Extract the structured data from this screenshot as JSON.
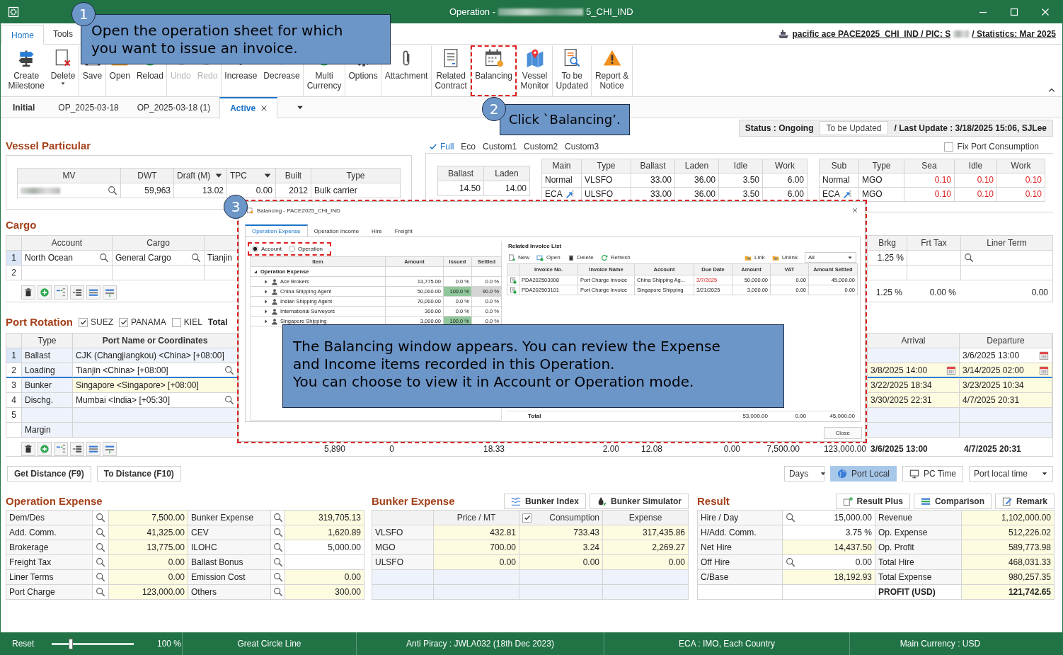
{
  "window": {
    "title_start": "Operation -",
    "title_end": "5_CHI_IND"
  },
  "ribbon": {
    "tabs": [
      {
        "label": "Home",
        "selected": true
      },
      {
        "label": "Tools",
        "selected": false
      }
    ],
    "context": {
      "start": "pacific ace PACE2025_CHI_IND / PIC: S",
      "end": "/ Statistics: Mar 2025"
    },
    "groups": [
      [
        {
          "label": "Create\nMilestone",
          "kind": "milestone",
          "disabled": false,
          "dropdown": false
        },
        {
          "label": "Delete",
          "kind": "delete",
          "disabled": false,
          "dropdown": true
        }
      ],
      [
        {
          "label": "Save",
          "kind": "save",
          "disabled": false,
          "dropdown": false
        }
      ],
      [
        {
          "label": "Open",
          "kind": "open",
          "disabled": false,
          "dropdown": false
        },
        {
          "label": "Reload",
          "kind": "reload",
          "disabled": false,
          "dropdown": false
        }
      ],
      [
        {
          "label": "Undo",
          "kind": "undo",
          "disabled": true,
          "dropdown": false
        },
        {
          "label": "Redo",
          "kind": "redo",
          "disabled": true,
          "dropdown": false
        }
      ],
      [
        {
          "label": "Increase",
          "kind": "increase",
          "disabled": false,
          "dropdown": false
        },
        {
          "label": "Decrease",
          "kind": "decrease",
          "disabled": false,
          "dropdown": false
        }
      ],
      [
        {
          "label": "Multi\nCurrency",
          "kind": "currency",
          "disabled": false,
          "dropdown": false
        }
      ],
      [
        {
          "label": "Options",
          "kind": "options",
          "disabled": false,
          "dropdown": false
        }
      ],
      [
        {
          "label": "Attachment",
          "kind": "attachment",
          "disabled": false,
          "dropdown": false
        }
      ],
      [
        {
          "label": "Related\nContract",
          "kind": "contract",
          "disabled": false,
          "dropdown": false
        }
      ],
      [
        {
          "label": "Balancing",
          "kind": "balancing",
          "disabled": false,
          "dropdown": false
        }
      ],
      [
        {
          "label": "Vessel\nMonitor",
          "kind": "map",
          "disabled": false,
          "dropdown": false
        }
      ],
      [
        {
          "label": "To be\nUpdated",
          "kind": "review",
          "disabled": false,
          "dropdown": false
        }
      ],
      [
        {
          "label": "Report &\nNotice",
          "kind": "warning",
          "disabled": false,
          "dropdown": false
        }
      ]
    ]
  },
  "doc_tabs": [
    {
      "label": "Initial",
      "kind": "base",
      "selected": false,
      "closable": false
    },
    {
      "label": "OP_2025-03-18",
      "kind": "version",
      "selected": false,
      "closable": false
    },
    {
      "label": "OP_2025-03-18 (1)",
      "kind": "version",
      "selected": false,
      "closable": false
    },
    {
      "label": "Active",
      "kind": "version",
      "selected": true,
      "closable": true
    }
  ],
  "status": {
    "label": "Status : Ongoing",
    "button": "To be Updated",
    "last_update": "/  Last Update : 3/18/2025 15:06, SJLee"
  },
  "vessel": {
    "title": "Vessel Particular",
    "columns": [
      {
        "label": "MV",
        "dropdown": false
      },
      {
        "label": "DWT",
        "dropdown": false
      },
      {
        "label": "Draft (M)",
        "dropdown": true
      },
      {
        "label": "TPC",
        "dropdown": true
      },
      {
        "label": "Built",
        "dropdown": false
      },
      {
        "label": "Type",
        "dropdown": false
      }
    ],
    "values": [
      "59,963",
      "13.02",
      "0.00",
      "2012",
      "Bulk carrier"
    ]
  },
  "speed": {
    "tabs": [
      {
        "label": "Full",
        "selected": true
      },
      {
        "label": "Eco",
        "selected": false
      },
      {
        "label": "Custom1",
        "selected": false
      },
      {
        "label": "Custom2",
        "selected": false
      },
      {
        "label": "Custom3",
        "selected": false
      }
    ],
    "fix_port_consumption": {
      "label": "Fix Port Consumption",
      "checked": false
    },
    "speed_columns": [
      "Ballast",
      "Laden"
    ],
    "speeds": [
      "14.50",
      "14.00"
    ],
    "main_columns": [
      "Main",
      "Type",
      "Ballast",
      "Laden",
      "Idle",
      "Work"
    ],
    "main_rows": [
      {
        "cells": [
          "Normal",
          "VLSFO",
          "33.00",
          "36.00",
          "3.50",
          "6.00"
        ],
        "eca": false
      },
      {
        "cells": [
          "ECA",
          "ULSFO",
          "33.00",
          "36.00",
          "3.50",
          "6.00"
        ],
        "eca": true
      }
    ],
    "sub_columns": [
      "Sub",
      "Type",
      "Sea",
      "Idle",
      "Work"
    ],
    "sub_rows": [
      {
        "cells": [
          "Normal",
          "MGO",
          "0.10",
          "0.10",
          "0.10"
        ],
        "eca": false,
        "alert": true
      },
      {
        "cells": [
          "ECA",
          "MGO",
          "0.10",
          "0.10",
          "0.10"
        ],
        "eca": true,
        "alert": true
      }
    ]
  },
  "cargo": {
    "title": "Cargo",
    "columns": [
      "Account",
      "Cargo"
    ],
    "rows": [
      {
        "number": "1",
        "account": "North Ocean",
        "cargo": "General Cargo",
        "column_3": "Tianjin",
        "selected": true
      },
      {
        "number": "2",
        "selected": false
      }
    ],
    "right_columns": [
      "Brkg",
      "Frt Tax",
      "Liner Term"
    ],
    "right_rows": [
      {
        "brkg": "1.25 %",
        "lookup": true
      },
      {
        "lookup": false
      }
    ],
    "totals": [
      "1.25 %",
      "0.00 %",
      "0.00"
    ]
  },
  "port_rotation": {
    "title": "Port Rotation",
    "canals": [
      {
        "label": "SUEZ",
        "checked": true
      },
      {
        "label": "PANAMA",
        "checked": true
      },
      {
        "label": "KIEL",
        "checked": false
      }
    ],
    "total_label": "Total",
    "columns": [
      "Type",
      "Port Name or Coordinates"
    ],
    "right_columns": [
      "Arrival",
      "Departure"
    ],
    "rows": [
      {
        "number": "1",
        "type": "Ballast",
        "port": "CJK (Changjiangkou) <China> [+08:00]",
        "lookup": false,
        "departure": "3/6/2025 13:00",
        "calendar": true,
        "kind": "ballast",
        "selected": true,
        "focused": false
      },
      {
        "number": "2",
        "type": "Loading",
        "port": "Tianjin <China> [+08:00]",
        "lookup": true,
        "arrival": "3/8/2025 14:00",
        "departure": "3/14/2025 02:00",
        "calendar": true,
        "kind": "call",
        "selected": false,
        "focused": true
      },
      {
        "number": "3",
        "type": "Bunker",
        "port": "Singapore <Singapore> [+08:00]",
        "lookup": false,
        "arrival": "3/22/2025 18:34",
        "departure": "3/23/2025 10:34",
        "calendar": false,
        "kind": "call",
        "selected": false,
        "focused": false
      },
      {
        "number": "4",
        "type": "Dischg.",
        "port": "Mumbai <India> [+05:30]",
        "lookup": true,
        "arrival": "3/30/2025 22:31",
        "departure": "4/7/2025 20:31",
        "calendar": false,
        "kind": "call",
        "selected": false,
        "focused": false
      },
      {
        "number": "5",
        "lookup": false,
        "calendar": false,
        "kind": "blank",
        "selected": false,
        "focused": false
      },
      {
        "type": "Margin",
        "lookup": false,
        "calendar": false,
        "kind": "margin",
        "selected": false,
        "focused": false
      }
    ],
    "totals": [
      "5,890",
      "0",
      "18.33",
      "2.00",
      "12.08",
      "0.00",
      "7,500.00",
      "123,000.00",
      "3/6/2025 13:00",
      "4/7/2025 20:31"
    ]
  },
  "controls": {
    "buttons": [
      "Get Distance (F9)",
      "To Distance (F10)"
    ],
    "unit": "Days",
    "time_modes": [
      {
        "label": "Port Local",
        "selected": true,
        "kind": "globe"
      },
      {
        "label": "PC Time",
        "selected": false,
        "kind": "monitor"
      }
    ],
    "time_display": "Port local time"
  },
  "operation_expense": {
    "title": "Operation Expense",
    "left": [
      {
        "label": "Dem/Des",
        "value": "7,500.00",
        "computed": true
      },
      {
        "label": "Add. Comm.",
        "value": "41,325.00",
        "computed": true
      },
      {
        "label": "Brokerage",
        "value": "13,775.00",
        "computed": true
      },
      {
        "label": "Freight Tax",
        "value": "0.00",
        "computed": true
      },
      {
        "label": "Liner Terms",
        "value": "0.00",
        "computed": true
      },
      {
        "label": "Port Charge",
        "value": "123,000.00",
        "computed": true
      }
    ],
    "right": [
      {
        "label": "Bunker Expense",
        "value": "319,705.13",
        "computed": true
      },
      {
        "label": "CEV",
        "value": "1,620.89",
        "computed": true
      },
      {
        "label": "ILOHC",
        "value": "5,000.00",
        "computed": false
      },
      {
        "label": "Ballast Bonus",
        "computed": false
      },
      {
        "label": "Emission Cost",
        "value": "0.00",
        "computed": true
      },
      {
        "label": "Others",
        "value": "300.00",
        "computed": true
      }
    ]
  },
  "bunker_expense": {
    "title": "Bunker Expense",
    "buttons": [
      {
        "label": "Bunker Index",
        "kind": "index"
      },
      {
        "label": "Bunker Simulator",
        "kind": "drop"
      }
    ],
    "columns": [
      "Price / MT",
      "Consumption",
      "Expense"
    ],
    "consumption_checked": true,
    "rows": [
      {
        "fuel": "VLSFO",
        "price": "432.81",
        "consumption": "733.43",
        "expense": "317,435.86"
      },
      {
        "fuel": "MGO",
        "price": "700.00",
        "consumption": "3.24",
        "expense": "2,269.27"
      },
      {
        "fuel": "ULSFO",
        "price": "0.00",
        "consumption": "0.00",
        "expense": "0.00"
      }
    ]
  },
  "result": {
    "title": "Result",
    "buttons": [
      {
        "label": "Result Plus",
        "kind": "plus"
      },
      {
        "label": "Comparison",
        "kind": "compare"
      },
      {
        "label": "Remark",
        "kind": "edit"
      }
    ],
    "left": [
      {
        "label": "Hire / Day",
        "value": "15,000.00",
        "lookup": true,
        "computed": false
      },
      {
        "label": "H/Add. Comm.",
        "value": "3.75 %",
        "lookup": false,
        "computed": false
      },
      {
        "label": "Net Hire",
        "value": "14,437.50",
        "lookup": false,
        "computed": true
      },
      {
        "label": "Off Hire",
        "value": "0.00",
        "lookup": true,
        "computed": false
      },
      {
        "label": "C/Base",
        "value": "18,192.93",
        "lookup": false,
        "computed": true
      }
    ],
    "right": [
      {
        "label": "Revenue",
        "value": "1,102,000.00",
        "kind": "line"
      },
      {
        "label": "Op. Expense",
        "value": "512,226.02",
        "kind": "line"
      },
      {
        "label": "Op. Profit",
        "value": "589,773.98",
        "kind": "line"
      },
      {
        "label": "Total Hire",
        "value": "468,031.33",
        "kind": "line"
      },
      {
        "label": "Total Expense",
        "value": "980,257.35",
        "kind": "line"
      },
      {
        "label": "PROFIT (USD)",
        "value": "121,742.65",
        "kind": "total"
      }
    ]
  },
  "status_bar": {
    "reset": "Reset",
    "zoom": {
      "level": 0.22
    },
    "zoom_label": "100 %",
    "items": [
      "Great Circle Line",
      "Anti Piracy : JWLA032 (18th Dec 2023)",
      "ECA : IMO, Each Country",
      "Main Currency : USD"
    ]
  },
  "balancing_dialog": {
    "title": "Balancing - PACE2025_CHI_IND",
    "tabs": [
      {
        "label": "Operation Expense",
        "selected": true
      },
      {
        "label": "Operation Income",
        "selected": false
      },
      {
        "label": "Hire",
        "selected": false
      },
      {
        "label": "Freight",
        "selected": false
      }
    ],
    "modes": [
      {
        "label": "Account",
        "selected": true
      },
      {
        "label": "Operation",
        "selected": false
      }
    ],
    "columns": [
      "Item",
      "Amount",
      "Issued",
      "Settled"
    ],
    "group": {
      "label": "Operation Expense",
      "expanded": true,
      "children": [
        {
          "label": "Ace Brokers",
          "amount": "13,775.00",
          "issued": "0.0 %",
          "settled": "0.0 %",
          "issued_full": false,
          "settled_partial": false
        },
        {
          "label": "China Shipping Agent",
          "amount": "50,000.00",
          "issued": "100.0 %",
          "settled": "90.0 %",
          "issued_full": true,
          "settled_partial": true
        },
        {
          "label": "Indian Shipping Agent",
          "amount": "70,000.00",
          "issued": "0.0 %",
          "settled": "0.0 %",
          "issued_full": false,
          "settled_partial": false
        },
        {
          "label": "International Surveyors",
          "amount": "300.00",
          "issued": "0.0 %",
          "settled": "0.0 %",
          "issued_full": false,
          "settled_partial": false
        },
        {
          "label": "Singapore Shipping",
          "amount": "3,000.00",
          "issued": "100.0 %",
          "settled": "0.0 %",
          "issued_full": true,
          "settled_partial": false
        }
      ]
    },
    "invoice_list": {
      "title": "Related Invoice List",
      "actions": [
        {
          "label": "New",
          "kind": "new"
        },
        {
          "label": "Open",
          "kind": "open"
        },
        {
          "label": "Delete",
          "kind": "delete"
        },
        {
          "label": "Refresh",
          "kind": "refresh"
        }
      ],
      "link_actions": [
        {
          "label": "Link",
          "kind": "link"
        },
        {
          "label": "Unlink",
          "kind": "unlink"
        }
      ],
      "filter": "All",
      "columns": [
        "Invoice No.",
        "Invoice Name",
        "Account",
        "Due Date",
        "Amount",
        "VAT",
        "Amount Settled"
      ],
      "rows": [
        {
          "invoice_no": "PDA202503008",
          "name": "Port Charge Invoice",
          "account": "China Shipping Ag...",
          "due_date": "3/7/2025",
          "overdue": true,
          "amount": "50,000.00",
          "vat": "0.00",
          "settled": "45,000.00"
        },
        {
          "invoice_no": "PDA202503101",
          "name": "Port Charge Invoice",
          "account": "Singapore Shipping",
          "due_date": "3/21/2025",
          "overdue": false,
          "amount": "3,000.00",
          "vat": "0.00",
          "settled": "0.00"
        }
      ],
      "total": {
        "label": "Total",
        "amount": "53,000.00",
        "vat": "0.00",
        "settled": "45,000.00"
      }
    },
    "close": "Close"
  },
  "annotations": [
    {
      "number": "1",
      "text": "Open the operation sheet for which\nyou want to issue an invoice."
    },
    {
      "number": "2",
      "text": "Click `Balancing’."
    },
    {
      "number": "3",
      "text": "The Balancing window appears. You can review the Expense\nand Income items recorded in this Operation.\nYou can choose to view it in Account or Operation mode."
    }
  ]
}
